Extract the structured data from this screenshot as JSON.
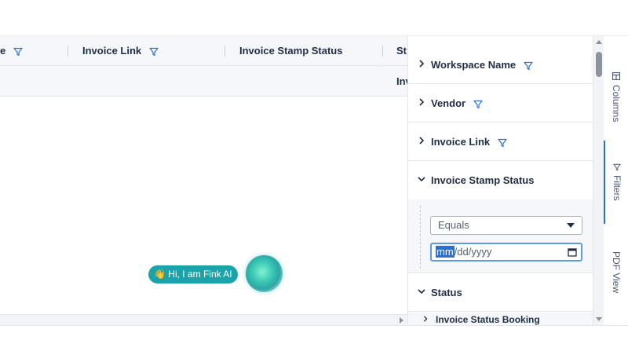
{
  "grid": {
    "columns": [
      {
        "label": "e",
        "has_filter": true
      },
      {
        "label": "Invoice Link",
        "has_filter": true
      },
      {
        "label": "Invoice Stamp Status",
        "has_filter": false
      },
      {
        "label": "St",
        "has_filter": false
      }
    ],
    "subheader": "Inv"
  },
  "assistant": {
    "bubble_text": "👋 Hi, I am Fink AI"
  },
  "filter_panel": {
    "groups": [
      {
        "label": "Workspace Name",
        "expanded": false,
        "has_filter": true
      },
      {
        "label": "Vendor",
        "expanded": false,
        "has_filter": true
      },
      {
        "label": "Invoice Link",
        "expanded": false,
        "has_filter": true
      },
      {
        "label": "Invoice Stamp Status",
        "expanded": true,
        "has_filter": false
      },
      {
        "label": "Status",
        "expanded": true,
        "has_filter": false
      }
    ],
    "operator_value": "Equals",
    "date_input": {
      "selected_segment": "mm",
      "rest": "/dd/yyyy"
    },
    "subgroup_label": "Invoice Status Booking"
  },
  "side_tabs": [
    {
      "label": "Columns",
      "icon": "columns-icon",
      "active": false
    },
    {
      "label": "Filters",
      "icon": "filter-icon",
      "active": true
    },
    {
      "label": "PDF View",
      "icon": "",
      "active": false
    }
  ],
  "colors": {
    "accent": "#2b6fd6",
    "assistant_bubble": "#1aa3a8",
    "header_bg": "#f5f7fa",
    "text": "#1f2d46"
  }
}
